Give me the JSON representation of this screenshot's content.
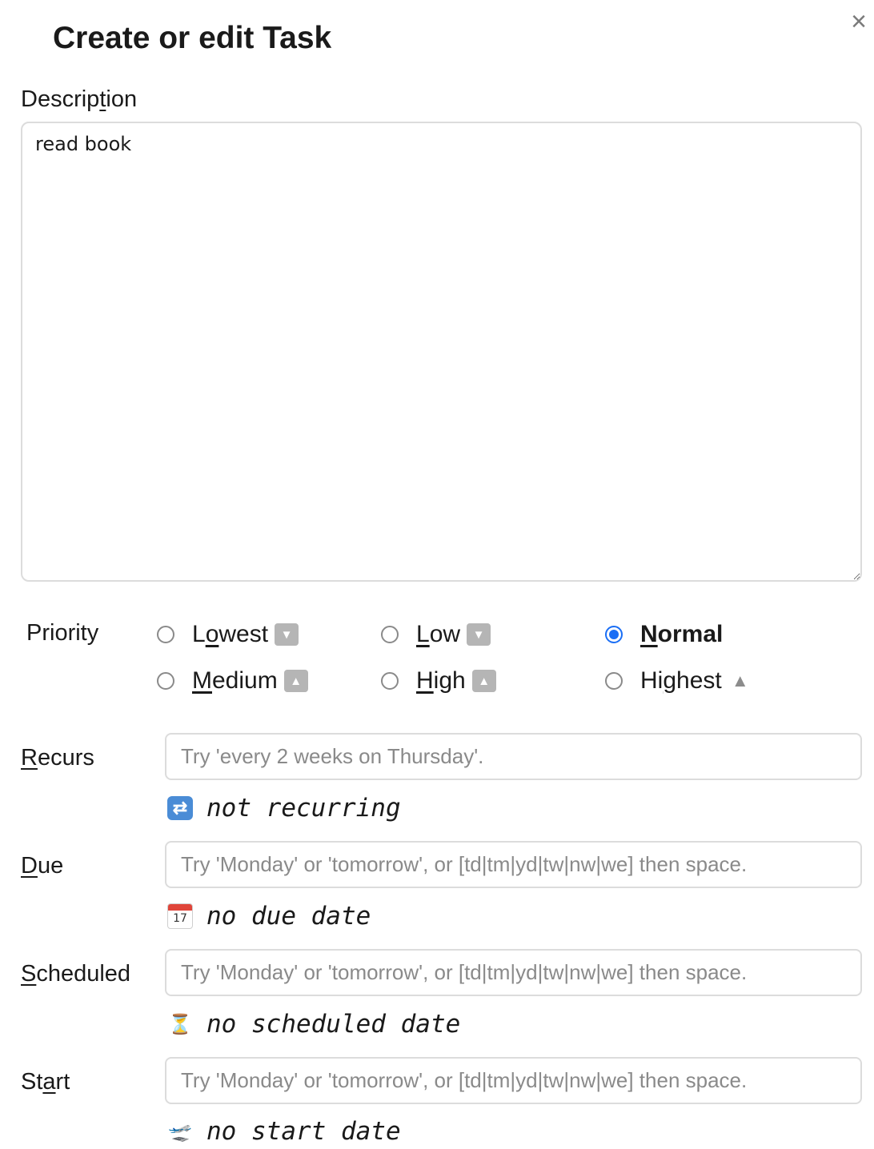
{
  "dialog": {
    "title": "Create or edit Task",
    "close_icon": "×"
  },
  "description": {
    "label_pre": "Descrip",
    "label_key": "t",
    "label_post": "ion",
    "value": "read book"
  },
  "priority": {
    "label": "Priority",
    "selected": "Normal",
    "options": [
      {
        "pre": "L",
        "key": "o",
        "post": "west",
        "icon": "lowest-priority-icon",
        "glyph": "⏬"
      },
      {
        "pre": "",
        "key": "L",
        "post": "ow",
        "icon": "low-priority-icon",
        "glyph": "🔽"
      },
      {
        "pre": "",
        "key": "N",
        "post": "ormal",
        "icon": "",
        "glyph": ""
      },
      {
        "pre": "",
        "key": "M",
        "post": "edium",
        "icon": "medium-priority-icon",
        "glyph": "🔼"
      },
      {
        "pre": "",
        "key": "H",
        "post": "igh",
        "icon": "high-priority-icon",
        "glyph": "⏫"
      },
      {
        "pre": "Hi",
        "key": "g",
        "post": "hest",
        "icon": "highest-priority-icon",
        "glyph": "▲"
      }
    ]
  },
  "recurs": {
    "label_key": "R",
    "label_post": "ecurs",
    "placeholder": "Try 'every 2 weeks on Thursday'.",
    "status_icon": "recurring-icon",
    "status": "not recurring"
  },
  "due": {
    "label_key": "D",
    "label_post": "ue",
    "placeholder": "Try 'Monday' or 'tomorrow', or [td|tm|yd|tw|nw|we] then space.",
    "status_icon": "calendar-icon",
    "calendar_day": "17",
    "status": "no due date"
  },
  "scheduled": {
    "label_key": "S",
    "label_post": "cheduled",
    "placeholder": "Try 'Monday' or 'tomorrow', or [td|tm|yd|tw|nw|we] then space.",
    "status_icon": "hourglass-icon",
    "status": "no scheduled date"
  },
  "start": {
    "label_pre": "St",
    "label_key": "a",
    "label_post": "rt",
    "placeholder": "Try 'Monday' or 'tomorrow', or [td|tm|yd|tw|nw|we] then space.",
    "status_icon": "airplane-departure-icon",
    "status": "no start date"
  }
}
